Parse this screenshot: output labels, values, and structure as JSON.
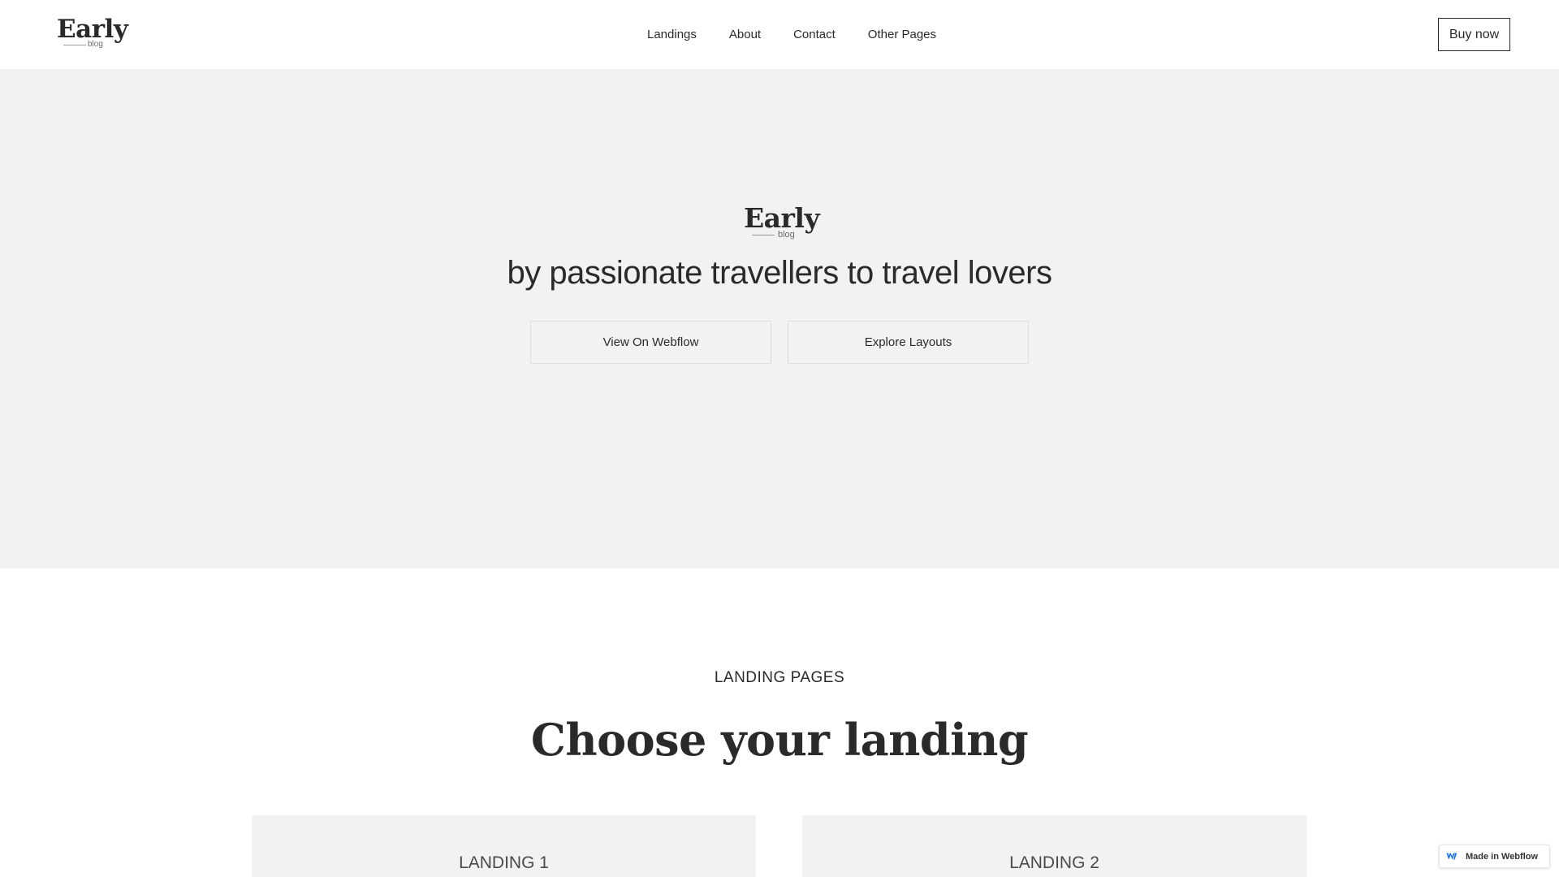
{
  "navbar": {
    "logo": {
      "word": "Early",
      "sub": "blog"
    },
    "links": [
      {
        "label": "Landings"
      },
      {
        "label": "About"
      },
      {
        "label": "Contact"
      },
      {
        "label": "Other Pages"
      }
    ],
    "buy_button": "Buy now"
  },
  "hero": {
    "logo": {
      "word": "Early",
      "sub": "blog"
    },
    "tagline": "by passionate travellers to travel lovers",
    "buttons": {
      "webflow": "View On Webflow",
      "layouts": "Explore Layouts"
    }
  },
  "landing_section": {
    "eyebrow": "LANDING PAGES",
    "title": "Choose your landing",
    "cards": [
      {
        "title": "LANDING 1"
      },
      {
        "title": "LANDING 2"
      }
    ]
  },
  "badge": {
    "label": "Made in Webflow",
    "icon": "webflow-icon"
  },
  "colors": {
    "text": "#2a2a2a",
    "hero_bg": "#f2f2f0",
    "page_bg": "#ffffff",
    "webflow_blue": "#146ef5"
  }
}
